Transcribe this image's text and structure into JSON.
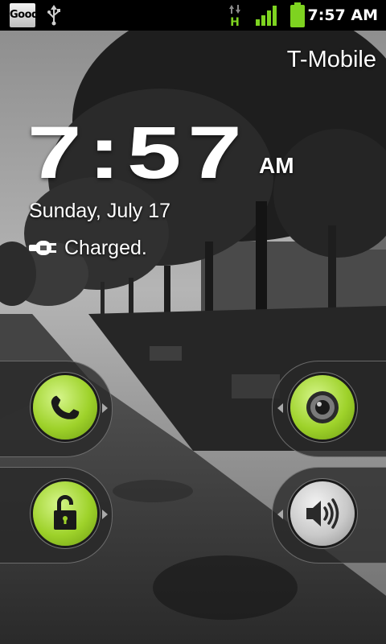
{
  "statusbar": {
    "notification_icon_label": "Good",
    "usb_icon": "usb-icon",
    "data_icon": "hsdpa-data-icon",
    "data_label": "H",
    "signal_icon": "signal-bars-icon",
    "battery_icon": "battery-full-icon",
    "time": "7:57 AM",
    "accent_color": "#7ed320"
  },
  "lockscreen": {
    "carrier": "T-Mobile",
    "clock": "7:57",
    "ampm": "AM",
    "date": "Sunday, July 17",
    "charge_status": "Charged.",
    "charge_icon": "plug-icon"
  },
  "slider_tabs": {
    "phone": {
      "icon": "phone-handset-icon",
      "color": "#9ed22a"
    },
    "unlock": {
      "icon": "unlock-padlock-icon",
      "color": "#9ed22a"
    },
    "camera": {
      "icon": "camera-lens-icon",
      "color": "#9ed22a"
    },
    "sound": {
      "icon": "speaker-volume-icon",
      "color": "#c9c9c9"
    }
  }
}
